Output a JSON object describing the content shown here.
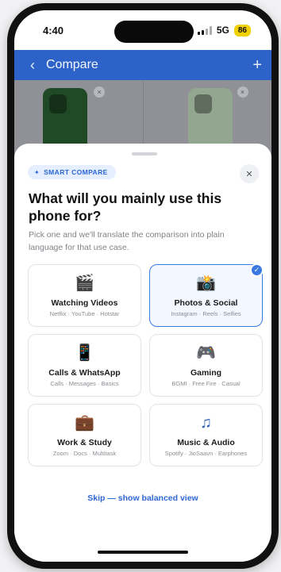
{
  "status_bar": {
    "time": "4:40",
    "network": "5G",
    "battery": "86"
  },
  "header": {
    "title": "Compare"
  },
  "sheet": {
    "badge_label": "SMART COMPARE",
    "title": "What will you mainly use this phone for?",
    "subtitle": "Pick one and we'll translate the comparison into plain language for that use case.",
    "options": [
      {
        "title": "Watching Videos",
        "sub": "Netflix · YouTube · Hotstar",
        "icon": "clapper-board-icon",
        "selected": false
      },
      {
        "title": "Photos & Social",
        "sub": "Instagram · Reels · Selfies",
        "icon": "camera-flash-icon",
        "selected": true
      },
      {
        "title": "Calls & WhatsApp",
        "sub": "Calls · Messages · Basics",
        "icon": "mobile-phone-icon",
        "selected": false
      },
      {
        "title": "Gaming",
        "sub": "BGMI · Free Fire · Casual",
        "icon": "game-controller-icon",
        "selected": false
      },
      {
        "title": "Work & Study",
        "sub": "Zoom · Docs · Multitask",
        "icon": "briefcase-icon",
        "selected": false
      },
      {
        "title": "Music & Audio",
        "sub": "Spotify · JioSaavn · Earphones",
        "icon": "music-note-icon",
        "selected": false
      }
    ],
    "skip_label": "Skip — show balanced view"
  },
  "colors": {
    "accent": "#2d63c9",
    "selected_border": "#3c7be6",
    "battery": "#f2d100"
  }
}
